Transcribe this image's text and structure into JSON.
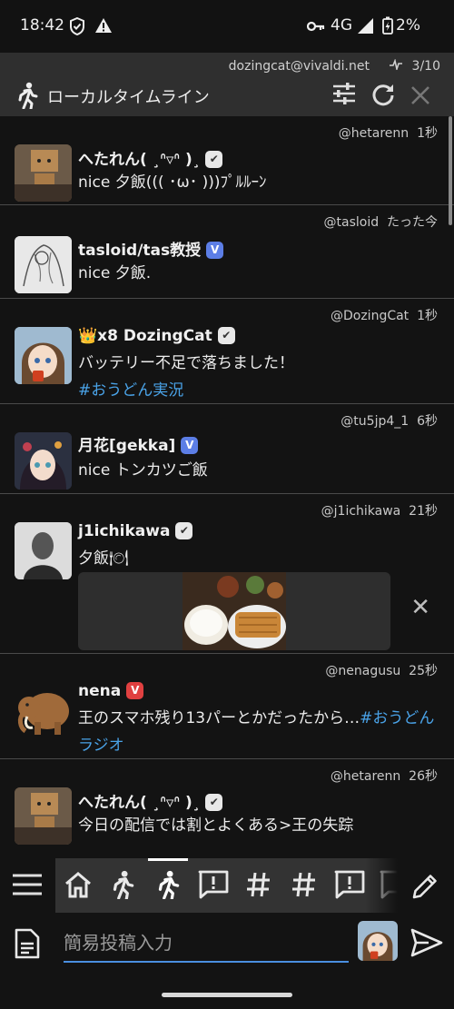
{
  "status_bar": {
    "time": "18:42",
    "network": "4G",
    "battery": "2%"
  },
  "column": {
    "account": "dozingcat@vivaldi.net",
    "counter": "3/10",
    "title": "ローカルタイムライン"
  },
  "posts": [
    {
      "handle": "@hetarenn",
      "age": "1秒",
      "name": "へたれん( ¸ᐢ▿ᐢ )¸",
      "badge": "✔",
      "text": "nice 夕飯((( ･ω･ )))ﾌﾟﾙﾙｰﾝ"
    },
    {
      "handle": "@tasloid",
      "age": "たった今",
      "name": "tasloid/tas教授",
      "badge": "V",
      "text": "nice 夕飯."
    },
    {
      "handle": "@DozingCat",
      "age": "1秒",
      "crown": "👑",
      "name": "x8 DozingCat",
      "badge": "✔",
      "text": "バッテリー不足で落ちました！",
      "hashtag": "#おうどん実況"
    },
    {
      "handle": "@tu5jp4_1",
      "age": "6秒",
      "name": "月花[gekka]",
      "badge": "V",
      "text": "nice トンカツご飯"
    },
    {
      "handle": "@j1ichikawa",
      "age": "21秒",
      "name": "j1ichikawa",
      "badge": "✔",
      "text": "夕飯🍽"
    },
    {
      "handle": "@nenagusu",
      "age": "25秒",
      "name": "nena",
      "badge": "V",
      "text": "王のスマホ残り13パーとかだったから…",
      "hashtag": "#おうどんラジオ"
    },
    {
      "handle": "@hetarenn",
      "age": "26秒",
      "name": "へたれん( ¸ᐢ▿ᐢ )¸",
      "badge": "✔",
      "text": "今日の配信では割とよくある>王の失踪"
    }
  ],
  "compose": {
    "placeholder": "簡易投稿入力"
  },
  "icons": {
    "walk": "walking-person-icon",
    "filter": "sliders-icon",
    "refresh": "refresh-icon",
    "close": "close-icon",
    "menu": "hamburger-menu-icon",
    "home": "home-icon",
    "hashtag": "hashtag-icon",
    "notification": "alert-speech-bubble-icon",
    "edit": "pencil-icon",
    "document": "document-icon",
    "send": "send-icon"
  },
  "colors": {
    "accent": "#4a8fe0",
    "hashtag": "#4aa3e8",
    "header_bg": "#2f2f2f",
    "background": "#131313"
  }
}
